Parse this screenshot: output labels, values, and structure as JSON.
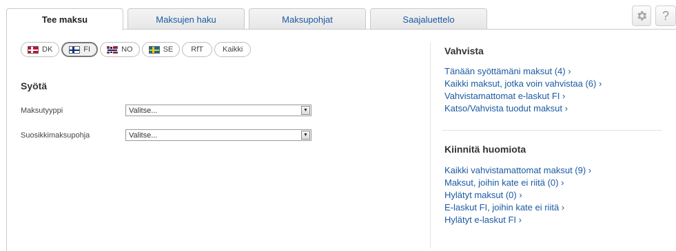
{
  "tabs": [
    {
      "label": "Tee maksu",
      "active": true
    },
    {
      "label": "Maksujen haku",
      "active": false
    },
    {
      "label": "Maksupohjat",
      "active": false
    },
    {
      "label": "Saajaluettelo",
      "active": false
    }
  ],
  "toolbar": {
    "settings_icon": "gear-icon",
    "help_label": "?"
  },
  "countries": [
    {
      "label": "DK",
      "flag": "dk",
      "active": false
    },
    {
      "label": "FI",
      "flag": "fi",
      "active": true
    },
    {
      "label": "NO",
      "flag": "no",
      "active": false
    },
    {
      "label": "SE",
      "flag": "se",
      "active": false
    },
    {
      "label": "RfT",
      "flag": null,
      "active": false
    },
    {
      "label": "Kaikki",
      "flag": null,
      "active": false
    }
  ],
  "form": {
    "title": "Syötä",
    "fields": [
      {
        "label": "Maksutyyppi",
        "value": "Valitse..."
      },
      {
        "label": "Suosikkimaksupohja",
        "value": "Valitse..."
      }
    ]
  },
  "confirm": {
    "title": "Vahvista",
    "links": [
      "Tänään syöttämäni maksut (4) ›",
      "Kaikki maksut, jotka voin vahvistaa (6) ›",
      "Vahvistamattomat e-laskut FI ›",
      "Katso/Vahvista tuodut maksut ›"
    ]
  },
  "attention": {
    "title": "Kiinnitä huomiota",
    "links": [
      "Kaikki vahvistamattomat maksut (9) ›",
      "Maksut, joihin kate ei riitä (0) ›",
      "Hylätyt maksut (0) ›",
      "E-laskut FI, joihin kate ei riitä ›",
      "Hylätyt e-laskut FI ›"
    ]
  },
  "colors": {
    "link": "#1a5aa3",
    "text": "#333333",
    "border": "#c9c9c9"
  }
}
